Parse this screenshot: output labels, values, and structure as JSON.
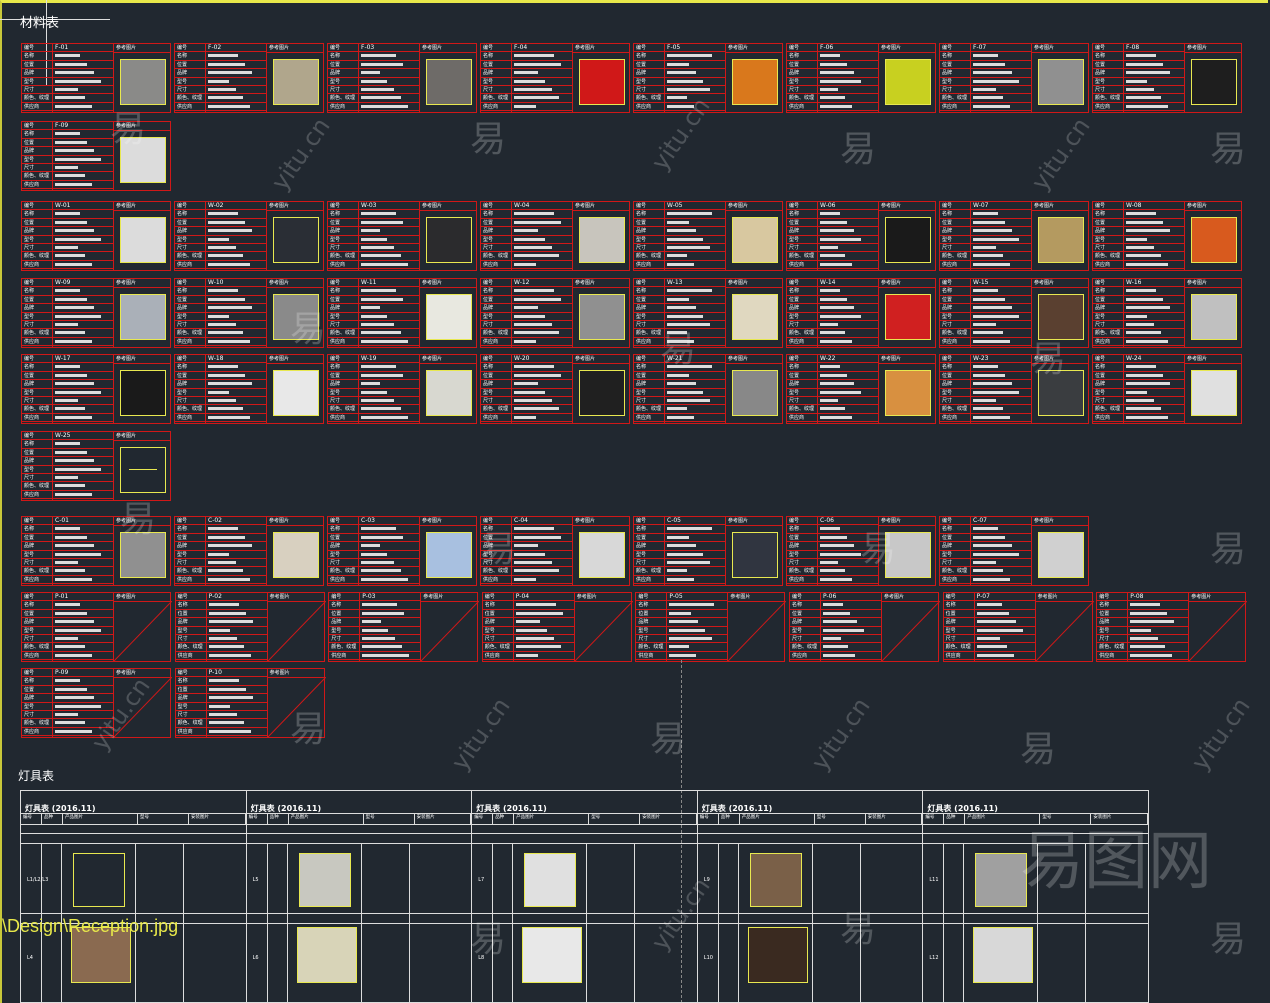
{
  "title": "材料表",
  "card_labels": [
    "编号",
    "名称",
    "位置",
    "品牌",
    "型号",
    "尺寸",
    "颜色、纹理",
    "供应商"
  ],
  "image_header": "参考图片",
  "groups": [
    {
      "rows": [
        [
          "F-01",
          "F-02",
          "F-03",
          "F-04",
          "F-05",
          "F-06",
          "F-07",
          "F-08"
        ],
        [
          "F-09"
        ]
      ],
      "swatches": {
        "F-01": "#8a8a88",
        "F-02": "#b0a68c",
        "F-03": "#6e6b68",
        "F-04": "#d01818",
        "F-05": "#d9781c",
        "F-06": "#c8d020",
        "F-07": "#909090",
        "F-08": "#1e1e1e",
        "F-09": "#dcdcdc"
      }
    },
    {
      "rows": [
        [
          "W-01",
          "W-02",
          "W-03",
          "W-04",
          "W-05",
          "W-06",
          "W-07",
          "W-08"
        ],
        [
          "W-09",
          "W-10",
          "W-11",
          "W-12",
          "W-13",
          "W-14",
          "W-15",
          "W-16"
        ],
        [
          "W-17",
          "W-18",
          "W-19",
          "W-20",
          "W-21",
          "W-22",
          "W-23",
          "W-24"
        ],
        [
          "W-25"
        ]
      ],
      "swatches": {
        "W-01": "#dcdcdc",
        "W-02": "#2a2e35",
        "W-03": "#2b2b2d",
        "W-04": "#c8c5bd",
        "W-05": "#d8c8a0",
        "W-06": "#1a1a1a",
        "W-07": "#b49a60",
        "W-08": "#d85a1e",
        "W-09": "#aab0b8",
        "W-10": "#8a8a8a",
        "W-11": "#e8e8e0",
        "W-12": "#909090",
        "W-13": "#e0d8c0",
        "W-14": "#d02020",
        "W-15": "#5a4030",
        "W-16": "#c0c0c0",
        "W-17": "#1a1a1a",
        "W-18": "#e8e8e8",
        "W-19": "#d8d8d0",
        "W-20": "#202020",
        "W-21": "#888888",
        "W-22": "#d89040",
        "W-23": "#3a3d40",
        "W-24": "#e0e0e0",
        "W-25": "#212830"
      }
    },
    {
      "rows": [
        [
          "C-01",
          "C-02",
          "C-03",
          "C-04",
          "C-05",
          "C-06",
          "C-07"
        ]
      ],
      "swatches": {
        "C-01": "#909090",
        "C-02": "#d8d0c0",
        "C-03": "#a8c0e0",
        "C-04": "#d8d8d8",
        "C-05": "#303540",
        "C-06": "#c8c8c8",
        "C-07": "#d0d0d0"
      }
    },
    {
      "rows": [
        [
          "P-01",
          "P-02",
          "P-03",
          "P-04",
          "P-05",
          "P-06",
          "P-07",
          "P-08"
        ],
        [
          "P-09",
          "P-10"
        ]
      ],
      "swatches": {}
    }
  ],
  "lamp_label": "灯具表",
  "lamp_table": {
    "title": "灯具表 (2016.11)",
    "headers": [
      "编号",
      "品种",
      "产品图片",
      "型号",
      "安装图片"
    ],
    "columns": [
      {
        "r1": "L1/L2/L3",
        "r2": "L4",
        "c1": "#212830",
        "c2": "#8a6a50"
      },
      {
        "r1": "L5",
        "r2": "L6",
        "c1": "#c8c8c0",
        "c2": "#d8d4b8"
      },
      {
        "r1": "L7",
        "r2": "L8",
        "c1": "#e0e0e0",
        "c2": "#e8e8e8"
      },
      {
        "r1": "L9",
        "r2": "L10",
        "c1": "#7a6048",
        "c2": "#3a2a20"
      },
      {
        "r1": "L11",
        "r2": "L12",
        "c1": "#a0a0a0",
        "c2": "#d8d8d8"
      }
    ]
  },
  "path_text": "\\Design\\Reception.jpg",
  "watermarks": {
    "char": "易",
    "url": "yitu.cn",
    "logo": "易图网"
  },
  "colors": {
    "border": "#d01818",
    "highlight": "#e8e850",
    "bg": "#212830"
  }
}
